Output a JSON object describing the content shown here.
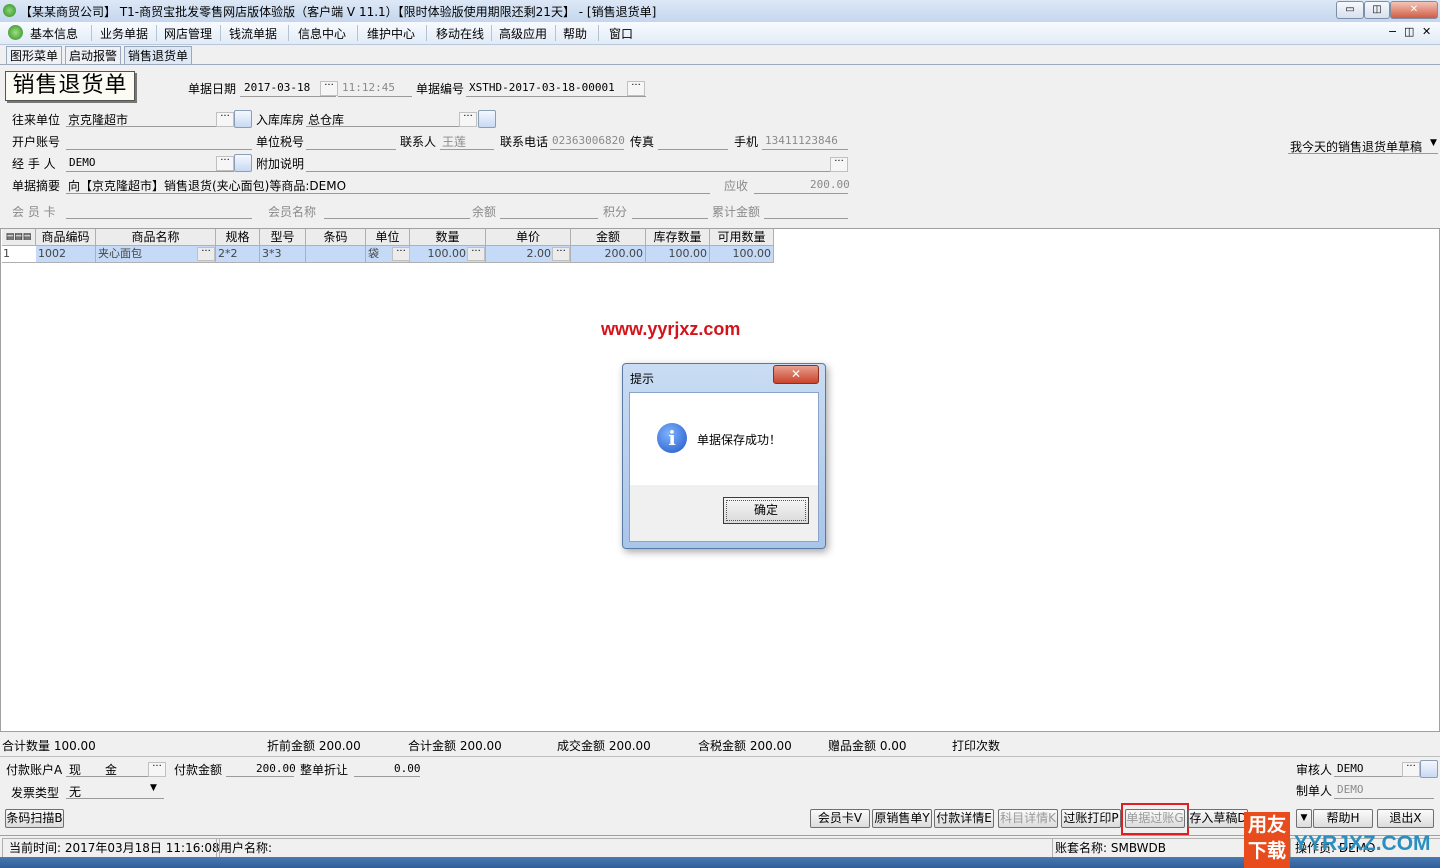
{
  "window": {
    "title": "【某某商贸公司】 T1-商贸宝批发零售网店版体验版（客户端 V 11.1）【限时体验版使用期限还剩21天】 - [销售退货单]",
    "btn_min": "▭",
    "btn_max": "◫",
    "btn_close": "✕"
  },
  "menubar": {
    "items": [
      "基本信息",
      "业务单据",
      "网店管理",
      "钱流单据",
      "信息中心",
      "维护中心",
      "移动在线",
      "高级应用",
      "帮助",
      "窗口"
    ],
    "right_controls": [
      "−",
      "◫",
      "✕"
    ]
  },
  "tabs": [
    "图形菜单",
    "启动报警",
    "销售退货单"
  ],
  "form": {
    "title": "销售退货单",
    "doc_date_label": "单据日期",
    "doc_date": "2017-03-18",
    "doc_time": "11:12:45",
    "doc_no_label": "单据编号",
    "doc_no": "XSTHD-2017-03-18-00001",
    "partner_label": "往来单位",
    "partner": "京克隆超市",
    "warehouse_label": "入库库房",
    "warehouse": "总仓库",
    "account_label": "开户账号",
    "account": "",
    "tax_no_label": "单位税号",
    "tax_no": "",
    "contact_label": "联系人",
    "contact": "王莲",
    "phone_label": "联系电话",
    "phone": "02363006820",
    "fax_label": "传真",
    "fax": "",
    "mobile_label": "手机",
    "mobile": "13411123846",
    "handler_label": "经 手 人",
    "handler": "DEMO",
    "note_label": "附加说明",
    "note": "",
    "summary_label": "单据摘要",
    "summary": "向【京克隆超市】销售退货(夹心面包)等商品:DEMO",
    "receivable_label": "应收",
    "receivable": "200.00",
    "member_card_label": "会 员 卡",
    "member_name_label": "会员名称",
    "balance_label": "余额",
    "points_label": "积分",
    "total_amount_label": "累计金额",
    "draft_select": "我今天的销售退货单草稿"
  },
  "grid": {
    "columns": [
      "商品编码",
      "商品名称",
      "规格",
      "型号",
      "条码",
      "单位",
      "数量",
      "单价",
      "金额",
      "库存数量",
      "可用数量"
    ],
    "rows": [
      {
        "idx": "1",
        "code": "1002",
        "name": "夹心面包",
        "spec": "2*2",
        "model": "3*3",
        "barcode": "",
        "unit": "袋",
        "qty": "100.00",
        "price": "2.00",
        "amount": "200.00",
        "stock": "100.00",
        "avail": "100.00"
      }
    ]
  },
  "totals": {
    "qty": "合计数量 100.00",
    "pre_discount": "折前金额 200.00",
    "total": "合计金额 200.00",
    "deal": "成交金额 200.00",
    "tax_incl": "含税金额 200.00",
    "gift": "赠品金额 0.00",
    "print_count": "打印次数"
  },
  "payment": {
    "account_label": "付款账户A",
    "account": "现　　金",
    "amount_label": "付款金额",
    "amount": "200.00",
    "discount_label": "整单折让",
    "discount": "0.00",
    "invoice_label": "发票类型",
    "invoice": "无",
    "auditor_label": "审核人",
    "auditor": "DEMO",
    "maker_label": "制单人",
    "maker": "DEMO"
  },
  "buttons": {
    "barcode": "条码扫描B",
    "member_card": "会员卡V",
    "orig_sale": "原销售单Y",
    "pay_detail": "付款详情E",
    "subject_detail": "科目详情K",
    "post_print": "过账打印P",
    "post": "单据过账G",
    "save_draft": "存入草稿D",
    "help": "帮助H",
    "exit": "退出X"
  },
  "status": {
    "time": "当前时间: 2017年03月18日 11:16:08",
    "user": "用户名称:",
    "set": "账套名称: SMBWDB",
    "operator": "操作员: DEMO"
  },
  "dialog": {
    "title": "提示",
    "close": "✕",
    "message": "单据保存成功！",
    "ok": "确定",
    "icon": "info-icon"
  },
  "watermark": "www.yyrjxz.com",
  "logo": {
    "text1": "用友",
    "text2": "下载",
    "text3": "YYRJXZ.COM"
  }
}
